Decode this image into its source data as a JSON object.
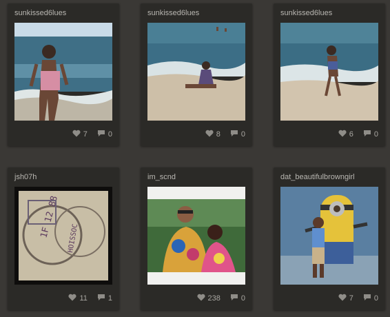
{
  "feed": {
    "cards": [
      {
        "username": "sunkissed6lues",
        "likes": "7",
        "comments": "0",
        "photo": "beach-girl-waves"
      },
      {
        "username": "sunkissed6lues",
        "likes": "8",
        "comments": "0",
        "photo": "beach-girl-sitting"
      },
      {
        "username": "sunkissed6lues",
        "likes": "6",
        "comments": "0",
        "photo": "beach-girl-walking"
      },
      {
        "username": "jsh07h",
        "likes": "11",
        "comments": "1",
        "photo": "passport-stamp"
      },
      {
        "username": "im_scnd",
        "likes": "238",
        "comments": "0",
        "photo": "tie-dye-couple"
      },
      {
        "username": "dat_beautifulbrowngirl",
        "likes": "7",
        "comments": "0",
        "photo": "boy-with-minion"
      }
    ]
  },
  "icons": {
    "like": "heart-icon",
    "comment": "comment-bubble-icon"
  },
  "colors": {
    "background": "#3a3835",
    "card": "#2b2a27",
    "text": "#b9b7b2"
  }
}
